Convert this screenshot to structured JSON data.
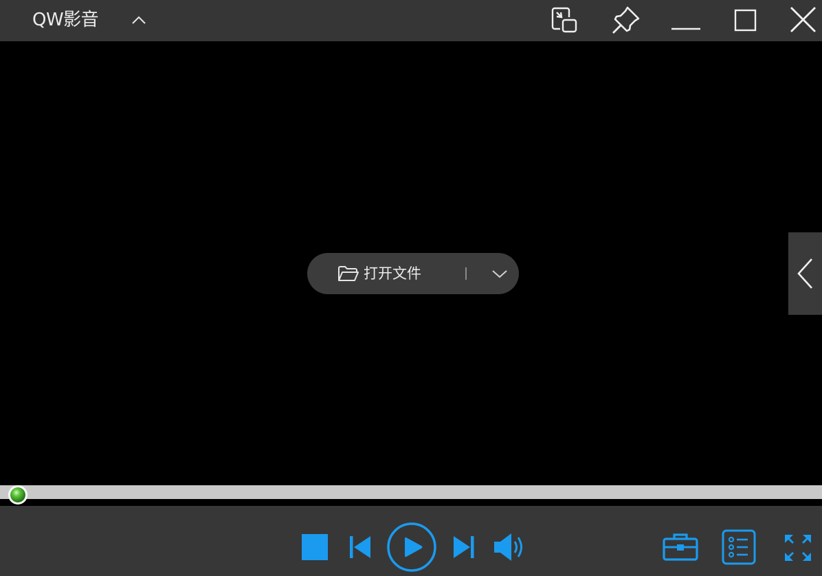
{
  "app": {
    "title": "QW影音"
  },
  "center": {
    "open_file_label": "打开文件"
  },
  "playback": {
    "progress": 0.0
  },
  "colors": {
    "accent": "#1a9bf0",
    "titlebar_bg": "#363636",
    "controlbar_bg": "#373737",
    "progress_track": "#c9c9c9",
    "knob": "#3fae2a"
  },
  "icons": {
    "titlebar": [
      "chevron-up-icon",
      "mini-mode-icon",
      "pin-icon",
      "minimize-icon",
      "maximize-icon",
      "close-icon"
    ],
    "controls": [
      "stop-icon",
      "previous-icon",
      "play-icon",
      "next-icon",
      "volume-icon"
    ],
    "tools": [
      "toolbox-icon",
      "playlist-icon",
      "fullscreen-icon"
    ],
    "side": "chevron-left-icon",
    "open": [
      "folder-icon",
      "chevron-down-icon"
    ]
  }
}
